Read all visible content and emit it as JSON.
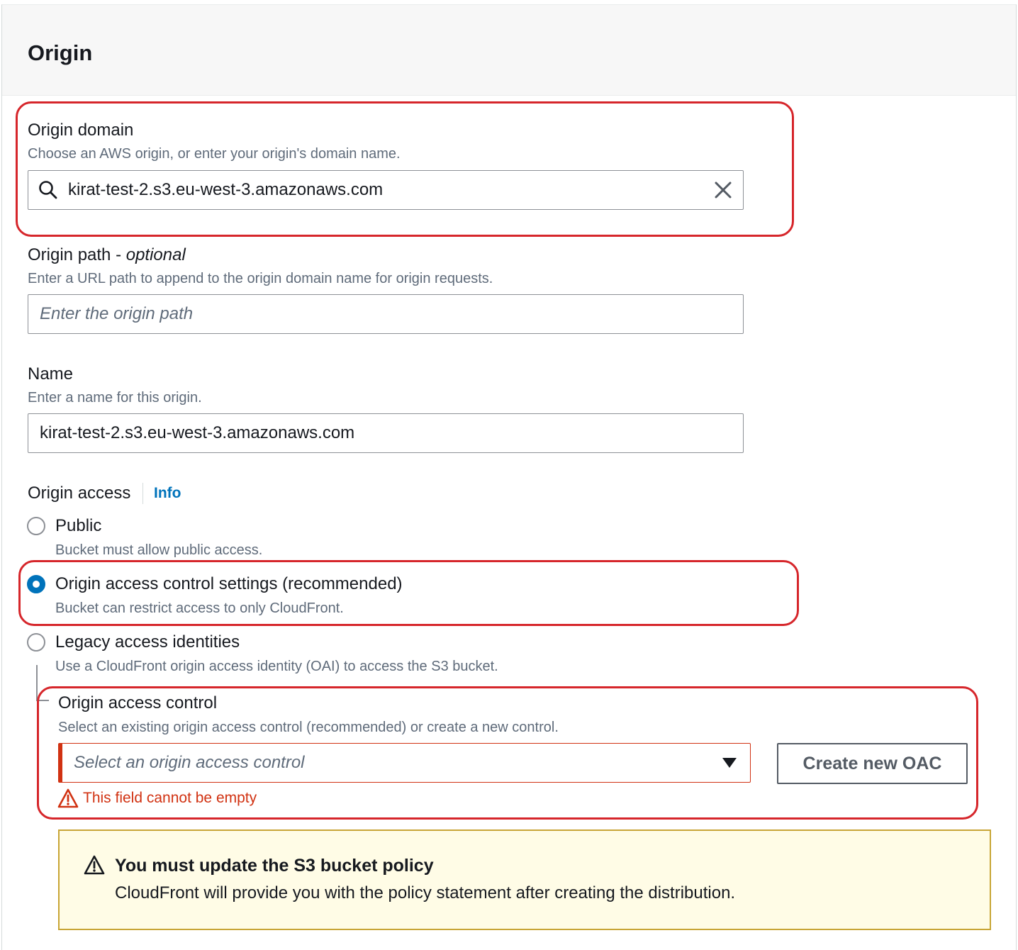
{
  "section": {
    "title": "Origin"
  },
  "origin_domain": {
    "label": "Origin domain",
    "description": "Choose an AWS origin, or enter your origin's domain name.",
    "value": "kirat-test-2.s3.eu-west-3.amazonaws.com"
  },
  "origin_path": {
    "label": "Origin path - ",
    "label_optional": "optional",
    "description": "Enter a URL path to append to the origin domain name for origin requests.",
    "placeholder": "Enter the origin path"
  },
  "name": {
    "label": "Name",
    "description": "Enter a name for this origin.",
    "value": "kirat-test-2.s3.eu-west-3.amazonaws.com"
  },
  "origin_access": {
    "label": "Origin access",
    "info_link": "Info",
    "options": [
      {
        "label": "Public",
        "description": "Bucket must allow public access.",
        "selected": false
      },
      {
        "label": "Origin access control settings (recommended)",
        "description": "Bucket can restrict access to only CloudFront.",
        "selected": true
      },
      {
        "label": "Legacy access identities",
        "description": "Use a CloudFront origin access identity (OAI) to access the S3 bucket.",
        "selected": false
      }
    ]
  },
  "oac": {
    "label": "Origin access control",
    "description": "Select an existing origin access control (recommended) or create a new control.",
    "placeholder": "Select an origin access control",
    "create_button": "Create new OAC",
    "error": "This field cannot be empty"
  },
  "alert": {
    "title": "You must update the S3 bucket policy",
    "body": "CloudFront will provide you with the policy statement after creating the distribution."
  },
  "colors": {
    "accent": "#0073bb",
    "error": "#d13212",
    "highlight": "#d6262b",
    "alert_bg": "#fffce6",
    "alert_border": "#c8a536"
  }
}
